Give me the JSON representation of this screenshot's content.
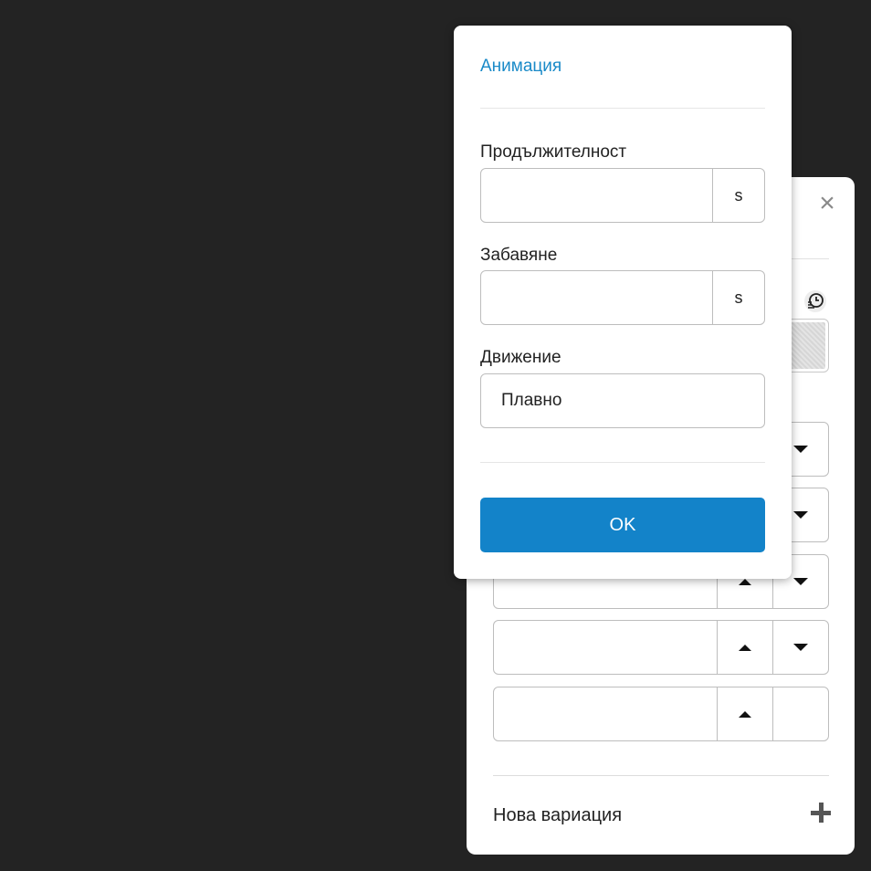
{
  "popup": {
    "title": "Анимация",
    "duration": {
      "label": "Продължителност",
      "value": "",
      "unit": "s"
    },
    "delay": {
      "label": "Забавяне",
      "value": "",
      "unit": "s"
    },
    "easing": {
      "label": "Движение",
      "value": "Плавно"
    },
    "ok_label": "OK"
  },
  "panel": {
    "close_icon": "close-icon",
    "history_icon": "history-icon",
    "new_variation_label": "Нова вариация",
    "add_icon": "plus-icon"
  },
  "colors": {
    "background": "#232323",
    "accent": "#1383c9",
    "title": "#1a8ac8"
  }
}
